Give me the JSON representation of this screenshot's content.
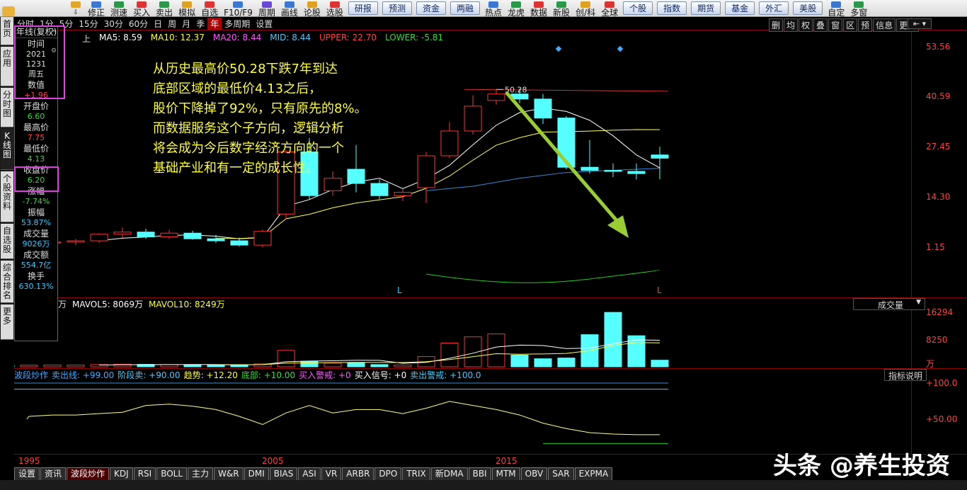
{
  "toolbar": {
    "items": [
      "修正",
      "测速",
      "买入",
      "卖出",
      "模拟",
      "自选",
      "F10/F9",
      "周期",
      "画线",
      "论股",
      "选股"
    ],
    "buttons": [
      "研报",
      "预测",
      "资金",
      "两融"
    ],
    "items2": [
      "热点",
      "龙虎",
      "数据",
      "新股",
      "创/科",
      "全球"
    ],
    "buttons2": [
      "个股",
      "指数",
      "期货",
      "基金",
      "外汇",
      "美股"
    ],
    "items3": [
      "自定",
      "多窗"
    ]
  },
  "left_tabs": [
    "首页",
    "应用",
    "分时图",
    "K线图",
    "个股资料",
    "自选股",
    "综合排名",
    "更多"
  ],
  "periods": [
    "分时",
    "1分",
    "5分",
    "15分",
    "30分",
    "60分",
    "日",
    "周",
    "月",
    "季",
    "年",
    "多周期",
    "设置"
  ],
  "active_period": "年",
  "right_tools": [
    "删",
    "均",
    "权",
    "叠",
    "窗",
    "区",
    "预",
    "信息",
    "更多"
  ],
  "ma_legend": {
    "prefix": "上",
    "ma5": "MA5: 8.59",
    "ma10": "MA10: 12.37",
    "ma20": "MA20: 8.44",
    "mid": "MID: 8.44",
    "upper": "UPPER: 22.70",
    "lower": "LOWER: -5.81"
  },
  "datawin": {
    "title": "年线(复权)",
    "rows": [
      {
        "label": "时间",
        "values": [
          "2021",
          "1231",
          "周五"
        ],
        "color": "#dddddd"
      },
      {
        "label": "数值",
        "values": [
          "+1.96"
        ],
        "color": "#ff4040"
      },
      {
        "label": "开盘价",
        "values": [
          "6.60"
        ],
        "color": "#33dd33"
      },
      {
        "label": "最高价",
        "values": [
          "7.75"
        ],
        "color": "#ff4040"
      },
      {
        "label": "最低价",
        "values": [
          "4.13"
        ],
        "color": "#33dd33"
      },
      {
        "label": "收盘价",
        "values": [
          "6.20"
        ],
        "color": "#33dd33"
      },
      {
        "label": "涨幅",
        "values": [
          "-7.74%"
        ],
        "color": "#33dd33"
      },
      {
        "label": "振幅",
        "values": [
          "53.87%"
        ],
        "color": "#33ccff"
      },
      {
        "label": "成交量",
        "values": [
          "9026万"
        ],
        "color": "#33ccff"
      },
      {
        "label": "成交额",
        "values": [
          "554.7亿"
        ],
        "color": "#33ccff"
      },
      {
        "label": "换手",
        "values": [
          "630.13%"
        ],
        "color": "#33ccff"
      }
    ]
  },
  "annotation": [
    "从历史最高价50.28下跌7年到达",
    "底部区域的最低价4.13之后，",
    "股价下降掉了92%，只有原先的8%。",
    "而数据服务这个子方向，逻辑分析",
    "将会成为今后数字经济方向的一个",
    "基础产业和有一定的成长性。"
  ],
  "price_axis": [
    "53.56",
    "40.59",
    "27.45",
    "14.30",
    "1.15"
  ],
  "peak_label": "50.28",
  "low_markers": [
    "L",
    "L"
  ],
  "vol_legend": {
    "prefix": "万",
    "mavol5": "MAVOL5: 8069万",
    "mavol10": "MAVOL10: 8249万",
    "select": "成交量"
  },
  "vol_axis": [
    "16294",
    "8250",
    "万"
  ],
  "ind_legend": {
    "name": "波段炒作",
    "sell_line": "卖出线: +99.00",
    "stage_sell": "阶段卖: +90.00",
    "trend": "趋势: +12.20",
    "bottom": "底部: +10.00",
    "buy_warn": "买入警戒: +0",
    "buy_signal": "买入信号: +0",
    "sell_warn": "卖出警戒: +100.0",
    "button": "指标说明"
  },
  "ind_axis": [
    "+100.0",
    "+50.00"
  ],
  "x_axis": [
    "1995",
    "2005",
    "2015"
  ],
  "bottom_tabs": [
    "设置",
    "资讯",
    "波段炒作",
    "KDJ",
    "RSI",
    "BOLL",
    "主力",
    "W&R",
    "DMI",
    "BIAS",
    "ASI",
    "VR",
    "ARBR",
    "DPO",
    "TRIX",
    "新DMA",
    "BBI",
    "MTM",
    "OBV",
    "SAR",
    "EXPMA"
  ],
  "active_bottom_tab": "波段炒作",
  "watermark": "头条 @养生投资",
  "chart_data": {
    "type": "candlestick",
    "y_scale": "log",
    "ylim": [
      0.9,
      60
    ],
    "x": [
      "1993",
      "1994",
      "1995",
      "1996",
      "1997",
      "1998",
      "1999",
      "2000",
      "2001",
      "2002",
      "2003",
      "2004",
      "2005",
      "2006",
      "2007",
      "2008",
      "2009",
      "2010",
      "2011",
      "2012",
      "2013",
      "2014",
      "2015",
      "2016",
      "2017",
      "2018",
      "2019",
      "2020",
      "2021"
    ],
    "ohlc": [
      [
        1.2,
        1.27,
        1.12,
        1.18
      ],
      [
        1.18,
        1.25,
        1.1,
        1.2
      ],
      [
        1.2,
        1.3,
        1.14,
        1.22
      ],
      [
        1.22,
        1.3,
        1.15,
        1.25
      ],
      [
        1.25,
        1.45,
        1.2,
        1.42
      ],
      [
        1.42,
        1.62,
        1.32,
        1.48
      ],
      [
        1.48,
        1.58,
        1.3,
        1.35
      ],
      [
        1.35,
        1.55,
        1.3,
        1.45
      ],
      [
        1.45,
        1.52,
        1.28,
        1.3
      ],
      [
        1.3,
        1.4,
        1.2,
        1.25
      ],
      [
        1.25,
        1.33,
        1.12,
        1.15
      ],
      [
        1.15,
        1.55,
        1.1,
        1.5
      ],
      [
        2.1,
        7.3,
        1.9,
        7.0
      ],
      [
        7.0,
        9.2,
        2.8,
        3.0
      ],
      [
        3.3,
        4.8,
        3.0,
        4.2
      ],
      [
        5.0,
        8.0,
        3.2,
        3.8
      ],
      [
        3.8,
        4.1,
        2.8,
        3.0
      ],
      [
        3.0,
        3.4,
        2.7,
        3.2
      ],
      [
        3.5,
        7.0,
        2.6,
        6.5
      ],
      [
        6.5,
        12.5,
        6.2,
        10.5
      ],
      [
        10.5,
        21.0,
        9.8,
        17.0
      ],
      [
        19.0,
        23.5,
        17.5,
        21.5
      ],
      [
        21.5,
        24.0,
        18.0,
        19.5
      ],
      [
        19.5,
        21.5,
        12.0,
        13.5
      ],
      [
        13.5,
        14.0,
        5.0,
        5.2
      ],
      [
        5.2,
        8.8,
        4.6,
        4.9
      ],
      [
        4.9,
        5.6,
        4.3,
        4.8
      ],
      [
        4.8,
        5.6,
        4.1,
        4.6
      ],
      [
        6.6,
        7.75,
        4.13,
        6.2
      ]
    ],
    "volume_wan": [
      400,
      450,
      500,
      480,
      600,
      700,
      650,
      600,
      550,
      520,
      500,
      800,
      4500,
      1500,
      1000,
      1200,
      600,
      500,
      2800,
      6500,
      8200,
      9000,
      3200,
      2200,
      2400,
      8800,
      14900,
      8500,
      1800
    ],
    "indicator": [
      46,
      50,
      52,
      52,
      54,
      56,
      66,
      68,
      65,
      60,
      50,
      38,
      55,
      66,
      55,
      60,
      60,
      54,
      62,
      72,
      66,
      60,
      52,
      40,
      32,
      26,
      24,
      23,
      23
    ]
  }
}
